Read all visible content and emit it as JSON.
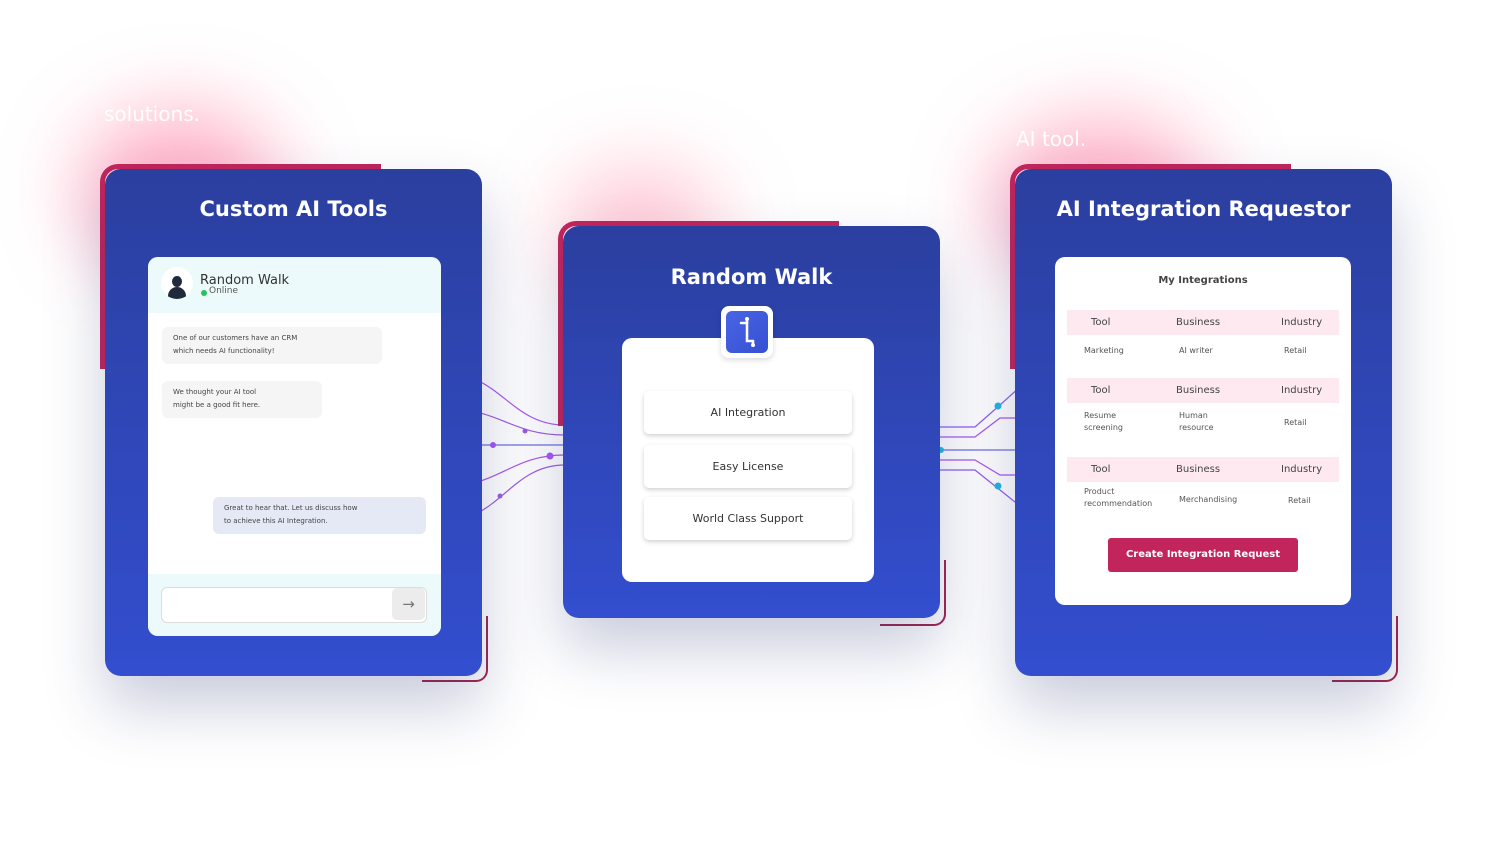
{
  "colors": {
    "panel_top": "#2b3f9f",
    "panel_bottom": "#334ecf",
    "accent": "#c2255c",
    "connector_purple": "#a855f7",
    "connector_cyan": "#22b7e0",
    "online": "#22c55e"
  },
  "background_text": {
    "left": "solutions.",
    "right": "AI tool."
  },
  "left_panel": {
    "title": "Custom AI Tools",
    "chat": {
      "contact_name": "Random Walk",
      "status": "Online",
      "avatar_icon": "user-avatar-icon",
      "messages": [
        {
          "direction": "incoming",
          "line1": "One of our customers have an CRM",
          "line2": "which needs AI functionality!"
        },
        {
          "direction": "incoming",
          "line1": "We thought your AI tool",
          "line2": "might be a good fit here."
        },
        {
          "direction": "outgoing",
          "line1": "Great to hear that. Let us discuss how",
          "line2": "to achieve this AI Integration."
        }
      ],
      "input_value": "",
      "send_icon": "arrow-right-icon"
    }
  },
  "middle_panel": {
    "title": "Random Walk",
    "logo_icon": "random-walk-logo-icon",
    "features": [
      "AI Integration",
      "Easy License",
      "World Class Support"
    ]
  },
  "right_panel": {
    "title": "AI Integration Requestor",
    "card_title": "My Integrations",
    "columns": [
      "Tool",
      "Business",
      "Industry"
    ],
    "rows": [
      {
        "tool": "Marketing",
        "business": "AI writer",
        "industry": "Retail"
      },
      {
        "tool": "Resume screening",
        "tool_l1": "Resume",
        "tool_l2": "screening",
        "business": "Human resource",
        "business_l1": "Human",
        "business_l2": "resource",
        "industry": "Retail"
      },
      {
        "tool": "Product recommendation",
        "tool_l1": "Product",
        "tool_l2": "recommendation",
        "business": "Merchandising",
        "industry": "Retail"
      }
    ],
    "button_label": "Create Integration Request"
  }
}
